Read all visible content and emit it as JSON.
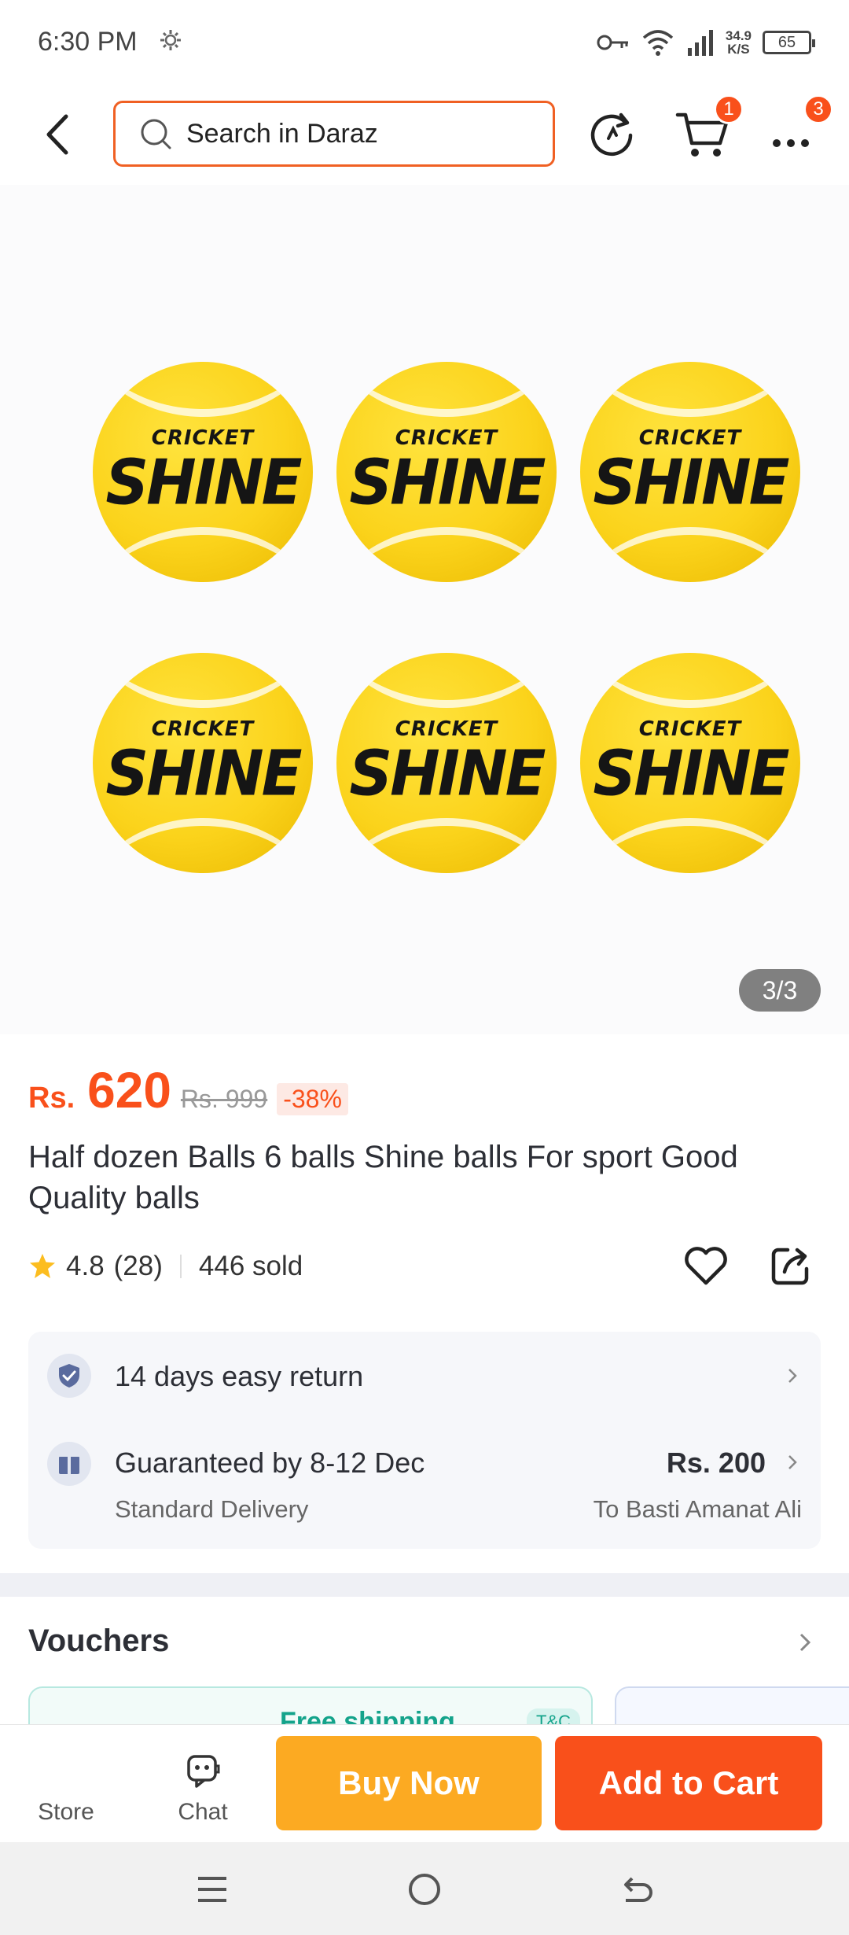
{
  "status_bar": {
    "time": "6:30 PM",
    "network_speed_value": "34.9",
    "network_speed_unit": "K/S",
    "battery": "65"
  },
  "top_nav": {
    "search_placeholder": "Search in Daraz",
    "cart_badge": "1",
    "more_badge": "3"
  },
  "gallery": {
    "counter": "3/3",
    "ball_brand_small": "CRICKET",
    "ball_brand_big": "SHINE"
  },
  "product": {
    "currency": "Rs.",
    "price": "620",
    "original_price": "Rs. 999",
    "discount": "-38%",
    "title": "Half dozen Balls 6 balls Shine balls For sport Good Quality balls",
    "rating": "4.8",
    "rating_count": "(28)",
    "sold": "446 sold"
  },
  "service": {
    "return_text": "14 days easy return",
    "delivery_text": "Guaranteed by 8-12 Dec",
    "delivery_type": "Standard Delivery",
    "delivery_fee": "Rs. 200",
    "delivery_location": "To Basti Amanat Ali"
  },
  "vouchers": {
    "title": "Vouchers",
    "card_label": "Free shipping",
    "card_tag": "T&C"
  },
  "bottom_bar": {
    "store_label": "Store",
    "chat_label": "Chat",
    "buy_now": "Buy Now",
    "add_to_cart": "Add to Cart"
  },
  "colors": {
    "accent": "#f9501b",
    "buy_now": "#fcaa22",
    "search_border": "#f06023",
    "voucher_teal": "#14a38b"
  },
  "icons": [
    "gear-icon",
    "key-icon",
    "wifi-icon",
    "signal-icon",
    "battery-icon",
    "back-icon",
    "search-icon",
    "refresh-icon",
    "cart-icon",
    "more-icon",
    "star-icon",
    "heart-icon",
    "share-icon",
    "shield-check-icon",
    "gift-icon",
    "chevron-right-icon",
    "store-icon",
    "chat-icon",
    "menu-icon",
    "home-icon",
    "back-nav-icon"
  ]
}
